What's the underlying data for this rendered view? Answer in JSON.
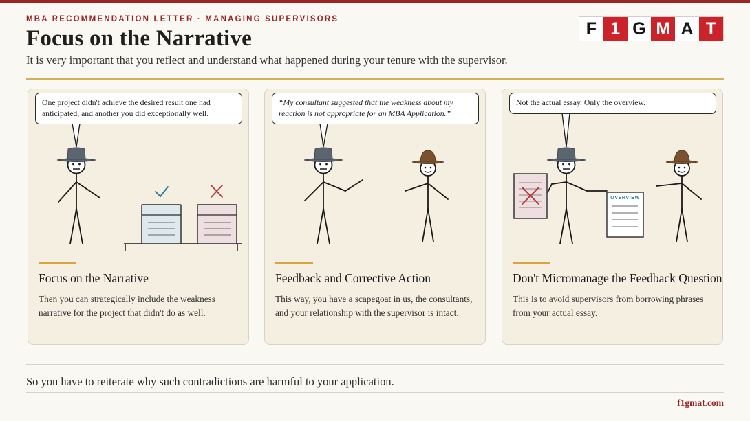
{
  "header": {
    "eyebrow": "MBA RECOMMENDATION LETTER · MANAGING SUPERVISORS",
    "title": "Focus on the Narrative",
    "subtitle": "It is very important that you reflect and understand what happened during your tenure with the supervisor."
  },
  "logo": {
    "letters": [
      "F",
      "1",
      "G",
      "M",
      "A",
      "T"
    ],
    "brand_red": "#cc2229"
  },
  "cards": [
    {
      "bubble": "One project didn't achieve the desired result one had anticipated, and another you did exceptionally well.",
      "title": "Focus on the Narrative",
      "body": "Then you can strategically include the weakness narrative for the project that didn't do as well.",
      "icons": [
        "stick-figure-hat",
        "check-icon",
        "cross-icon",
        "document-icon"
      ]
    },
    {
      "bubble": "“My consultant suggested that the weakness about my reaction is not appropriate for an MBA Application.”",
      "title": "Feedback and Corrective Action",
      "body": "This way, you have a scapegoat in us, the consultants, and your relationship with the supervisor is intact.",
      "icons": [
        "stick-figure-hat",
        "stick-figure-brown-hat"
      ]
    },
    {
      "bubble": "Not the actual essay. Only the overview.",
      "title": "Don't Micromanage the Feedback Question",
      "body": "This is to avoid supervisors from borrowing phrases from your actual essay.",
      "doc_label": "OVERVIEW",
      "icons": [
        "crossed-document-icon",
        "stick-figure-hat",
        "overview-document-icon",
        "stick-figure-brown-hat"
      ]
    }
  ],
  "bottom_text": "So you have to reiterate why such contradictions are harmful to your application.",
  "footer": "f1gmat.com",
  "colors": {
    "accent_red": "#9b2424",
    "gold_rule": "#d4b255",
    "card_bg": "#f4efe0",
    "hat_grey": "#5b6570",
    "hat_brown": "#7a5230",
    "check_blue": "#2b7f9e"
  }
}
